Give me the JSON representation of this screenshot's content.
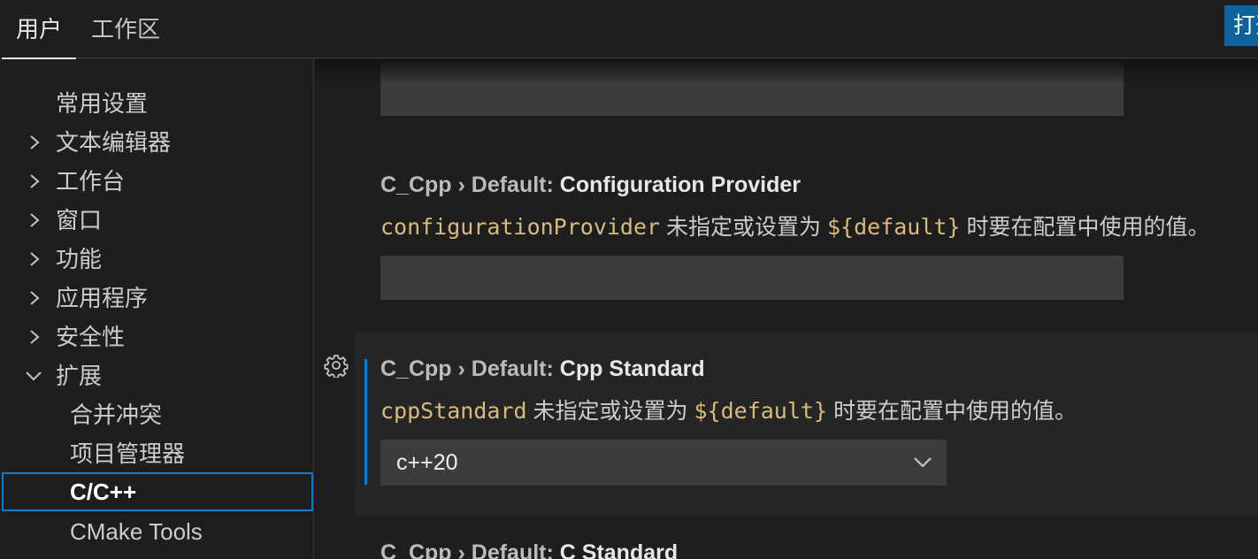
{
  "tabs": {
    "user": "用户",
    "workspace": "工作区"
  },
  "open_button": {
    "label": "打开"
  },
  "sidebar": {
    "items": [
      {
        "label": "常用设置"
      },
      {
        "label": "文本编辑器"
      },
      {
        "label": "工作台"
      },
      {
        "label": "窗口"
      },
      {
        "label": "功能"
      },
      {
        "label": "应用程序"
      },
      {
        "label": "安全性"
      },
      {
        "label": "扩展"
      }
    ],
    "children": [
      {
        "label": "合并冲突"
      },
      {
        "label": "项目管理器"
      },
      {
        "label": "C/C++"
      },
      {
        "label": "CMake Tools"
      }
    ]
  },
  "settings": {
    "configuration_provider": {
      "category": "C_Cpp › Default: ",
      "name": "Configuration Provider",
      "key": "configurationProvider",
      "desc_mid": " 未指定或设置为 ",
      "token": "${default}",
      "desc_end": " 时要在配置中使用的值。"
    },
    "cpp_standard": {
      "category": "C_Cpp › Default: ",
      "name": "Cpp Standard",
      "key": "cppStandard",
      "desc_mid": " 未指定或设置为 ",
      "token": "${default}",
      "desc_end": " 时要在配置中使用的值。",
      "value": "c++20"
    },
    "c_standard": {
      "category": "C_Cpp › Default: ",
      "name": "C Standard"
    }
  },
  "colors": {
    "accent": "#007fd4",
    "button": "#0e639c",
    "code": "#d7ba7d"
  }
}
